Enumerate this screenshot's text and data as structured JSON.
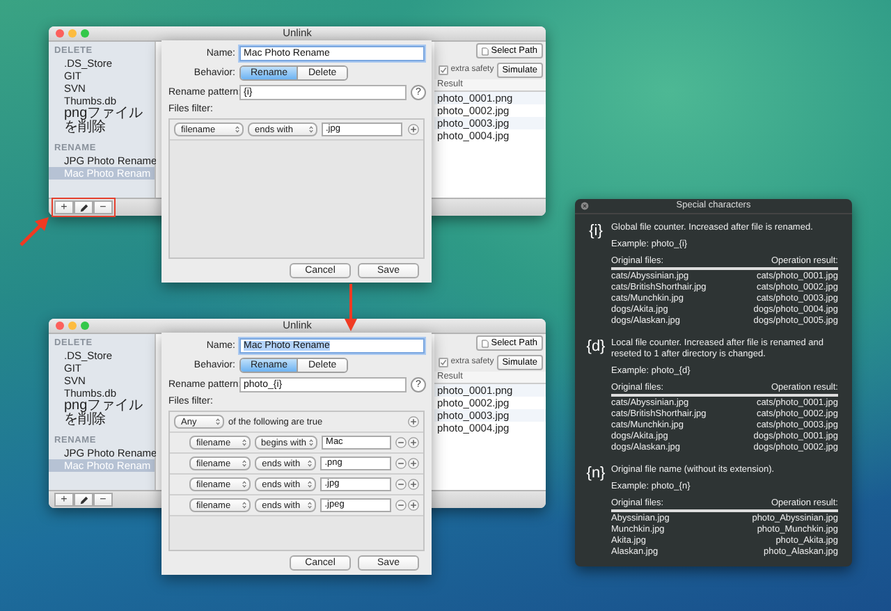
{
  "windows": [
    {
      "title": "Unlink",
      "sidebar": {
        "sections": [
          {
            "heading": "DELETE",
            "items": [
              {
                "label": ".DS_Store",
                "selected": false
              },
              {
                "label": "GIT",
                "selected": false
              },
              {
                "label": "SVN",
                "selected": false
              },
              {
                "label": "Thumbs.db",
                "selected": false
              },
              {
                "label": "pngファイルを削除",
                "selected": false
              }
            ]
          },
          {
            "heading": "RENAME",
            "items": [
              {
                "label": "JPG Photo Rename",
                "selected": false
              },
              {
                "label": "Mac Photo Renam",
                "selected": true
              }
            ]
          }
        ]
      },
      "toolbar_buttons": [
        "+",
        "−"
      ],
      "toolbar_highlighted": true,
      "content": {
        "path_button": "Select Path",
        "checkbox_label": "extra safety",
        "checked": true,
        "simulate_button": "Simulate",
        "column": "Result",
        "results": [
          "photo_0001.png",
          "photo_0002.jpg",
          "photo_0003.jpg",
          "photo_0004.jpg"
        ]
      },
      "sheet": {
        "name_label": "Name:",
        "name": "Mac Photo Rename",
        "name_selected": false,
        "behavior_label": "Behavior:",
        "behavior_options": [
          {
            "label": "Rename",
            "selected": true
          },
          {
            "label": "Delete",
            "selected": false
          }
        ],
        "pattern_label": "Rename pattern:",
        "pattern": "{i}",
        "help": "?",
        "filter_label": "Files filter:",
        "filters": [
          {
            "field": "filename",
            "operator": "ends with",
            "value": ".jpg",
            "removable": false
          }
        ],
        "buttons": [
          "Cancel",
          "Save"
        ]
      }
    },
    {
      "title": "Unlink",
      "sidebar": {
        "sections": [
          {
            "heading": "DELETE",
            "items": [
              {
                "label": ".DS_Store",
                "selected": false
              },
              {
                "label": "GIT",
                "selected": false
              },
              {
                "label": "SVN",
                "selected": false
              },
              {
                "label": "Thumbs.db",
                "selected": false
              },
              {
                "label": "pngファイルを削除",
                "selected": false
              }
            ]
          },
          {
            "heading": "RENAME",
            "items": [
              {
                "label": "JPG Photo Rename",
                "selected": false
              },
              {
                "label": "Mac Photo Renam",
                "selected": true
              }
            ]
          }
        ]
      },
      "toolbar_buttons": [
        "+",
        "−"
      ],
      "toolbar_highlighted": false,
      "content": {
        "path_button": "Select Path",
        "checkbox_label": "extra safety",
        "checked": true,
        "simulate_button": "Simulate",
        "column": "Result",
        "results": [
          "photo_0001.png",
          "photo_0002.jpg",
          "photo_0003.jpg",
          "photo_0004.jpg"
        ]
      },
      "sheet": {
        "name_label": "Name:",
        "name": "Mac Photo Rename",
        "name_selected": true,
        "behavior_label": "Behavior:",
        "behavior_options": [
          {
            "label": "Rename",
            "selected": true
          },
          {
            "label": "Delete",
            "selected": false
          }
        ],
        "pattern_label": "Rename pattern:",
        "pattern": "photo_{i}",
        "help": "?",
        "filter_label": "Files filter:",
        "match": {
          "option": "Any",
          "text": "of the following are true"
        },
        "filters": [
          {
            "field": "filename",
            "operator": "begins with",
            "value": "Mac",
            "removable": true
          },
          {
            "field": "filename",
            "operator": "ends with",
            "value": ".png",
            "removable": true
          },
          {
            "field": "filename",
            "operator": "ends with",
            "value": ".jpg",
            "removable": true
          },
          {
            "field": "filename",
            "operator": "ends with",
            "value": ".jpeg",
            "removable": true
          }
        ],
        "buttons": [
          "Cancel",
          "Save"
        ]
      }
    }
  ],
  "special_characters": {
    "title": "Special characters",
    "sections": [
      {
        "token": "{i}",
        "description": "Global file counter. Increased after file is renamed.",
        "example": "Example: photo_{i}",
        "original_header": "Original files:",
        "result_header": "Operation result:",
        "rows": [
          {
            "original": "cats/Abyssinian.jpg",
            "result": "cats/photo_0001.jpg"
          },
          {
            "original": "cats/BritishShorthair.jpg",
            "result": "cats/photo_0002.jpg"
          },
          {
            "original": "cats/Munchkin.jpg",
            "result": "cats/photo_0003.jpg"
          },
          {
            "original": "dogs/Akita.jpg",
            "result": "dogs/photo_0004.jpg"
          },
          {
            "original": "dogs/Alaskan.jpg",
            "result": "dogs/photo_0005.jpg"
          }
        ]
      },
      {
        "token": "{d}",
        "description": "Local file counter. Increased after file is renamed and reseted to 1 after directory is changed.",
        "example": "Example: photo_{d}",
        "original_header": "Original files:",
        "result_header": "Operation result:",
        "rows": [
          {
            "original": "cats/Abyssinian.jpg",
            "result": "cats/photo_0001.jpg"
          },
          {
            "original": "cats/BritishShorthair.jpg",
            "result": "cats/photo_0002.jpg"
          },
          {
            "original": "cats/Munchkin.jpg",
            "result": "cats/photo_0003.jpg"
          },
          {
            "original": "dogs/Akita.jpg",
            "result": "dogs/photo_0001.jpg"
          },
          {
            "original": "dogs/Alaskan.jpg",
            "result": "dogs/photo_0002.jpg"
          }
        ]
      },
      {
        "token": "{n}",
        "description": "Original file name (without its extension).",
        "example": "Example: photo_{n}",
        "original_header": "Original files:",
        "result_header": "Operation result:",
        "rows": [
          {
            "original": "Abyssinian.jpg",
            "result": "photo_Abyssinian.jpg"
          },
          {
            "original": "Munchkin.jpg",
            "result": "photo_Munchkin.jpg"
          },
          {
            "original": "Akita.jpg",
            "result": "photo_Akita.jpg"
          },
          {
            "original": "Alaskan.jpg",
            "result": "photo_Alaskan.jpg"
          }
        ]
      }
    ]
  }
}
